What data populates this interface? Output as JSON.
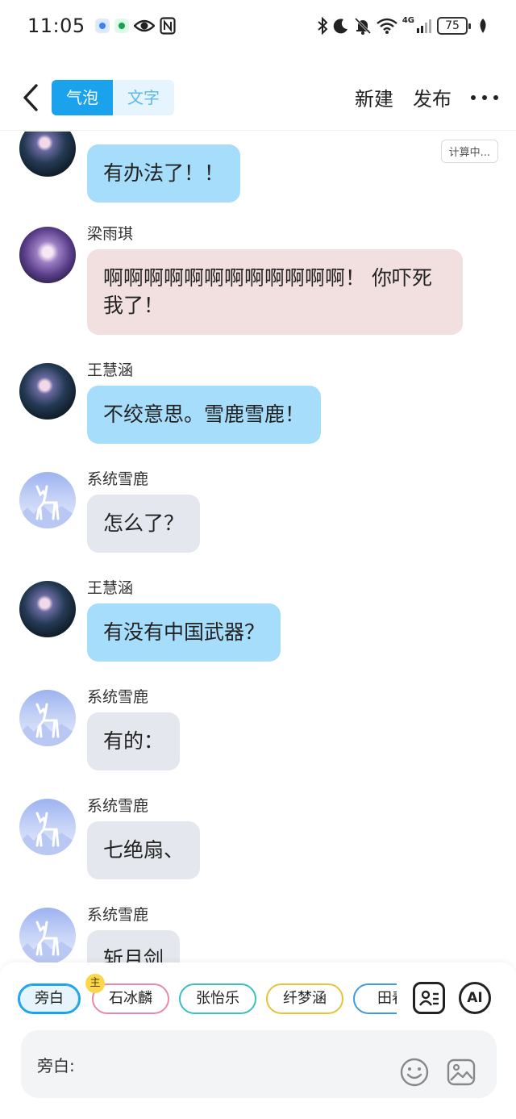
{
  "status_bar": {
    "time": "11:05",
    "network": "4G",
    "battery": "75",
    "icons": [
      "app-notification-icon",
      "app-notification-icon",
      "eye-icon",
      "nfc-icon",
      "bluetooth-icon",
      "moon-icon",
      "mute-bell-icon",
      "wifi-icon",
      "signal-icon",
      "battery-icon",
      "leaf-icon"
    ]
  },
  "header": {
    "back_icon": "chevron-left-icon",
    "modes": [
      {
        "label": "气泡",
        "active": true
      },
      {
        "label": "文字",
        "active": false
      }
    ],
    "new_label": "新建",
    "publish_label": "发布",
    "more_icon": "more-dots-icon"
  },
  "chat": {
    "calc_badge": "计算中...",
    "messages": [
      {
        "sender": "",
        "text": "有办法了！！",
        "bubble": "blue",
        "avatar": "王慧涵"
      },
      {
        "sender": "梁雨琪",
        "text": "啊啊啊啊啊啊啊啊啊啊啊啊！ 你吓死我了！",
        "bubble": "pink",
        "avatar": "梁雨琪"
      },
      {
        "sender": "王慧涵",
        "text": "不绞意思。雪鹿雪鹿！",
        "bubble": "blue",
        "avatar": "王慧涵"
      },
      {
        "sender": "系统雪鹿",
        "text": "怎么了？",
        "bubble": "gray",
        "avatar": "系统雪鹿"
      },
      {
        "sender": "王慧涵",
        "text": "有没有中国武器？",
        "bubble": "blue",
        "avatar": "王慧涵"
      },
      {
        "sender": "系统雪鹿",
        "text": "有的：",
        "bubble": "gray",
        "avatar": "系统雪鹿"
      },
      {
        "sender": "系统雪鹿",
        "text": "七绝扇、",
        "bubble": "gray",
        "avatar": "系统雪鹿"
      },
      {
        "sender": "系统雪鹿",
        "text": "斩月剑",
        "bubble": "gray",
        "avatar": "系统雪鹿"
      }
    ]
  },
  "roles": {
    "host_badge": "主",
    "chips": [
      {
        "label": "旁白",
        "color": "#1aa3ec",
        "active": true
      },
      {
        "label": "石冰麟",
        "color": "#e88aa5",
        "active": false
      },
      {
        "label": "张怡乐",
        "color": "#3bbfbf",
        "active": false
      },
      {
        "label": "纤梦涵",
        "color": "#e8c23a",
        "active": false
      },
      {
        "label": "田春",
        "color": "#3d9be0",
        "active": false
      }
    ],
    "contact_icon": "contact-card-icon",
    "ai_label": "AI"
  },
  "input": {
    "label": "旁白:",
    "emoji_icon": "emoji-icon",
    "image_icon": "image-icon"
  }
}
